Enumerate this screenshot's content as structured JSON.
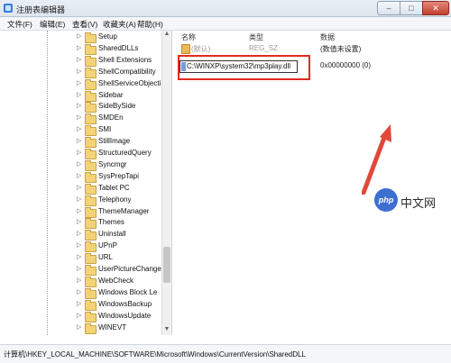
{
  "window": {
    "title": "注册表编辑器",
    "min_label": "–",
    "max_label": "□",
    "close_label": "✕"
  },
  "menu": [
    "文件(F)",
    "编辑(E)",
    "查看(V)",
    "收藏夹(A)",
    "帮助(H)"
  ],
  "tree": {
    "items": [
      "Setup",
      "SharedDLLs",
      "Shell Extensions",
      "ShellCompatibility",
      "ShellServiceObjecti",
      "Sidebar",
      "SideBySide",
      "SMDEn",
      "SMI",
      "StillImage",
      "StructuredQuery",
      "Syncmgr",
      "SysPrepTapi",
      "Tablet PC",
      "Telephony",
      "ThemeManager",
      "Themes",
      "Uninstall",
      "UPnP",
      "URL",
      "UserPictureChange",
      "WebCheck",
      "Windows Block Le",
      "WindowsBackup",
      "WindowsUpdate",
      "WINEVT"
    ]
  },
  "values": {
    "headers": {
      "name": "名称",
      "type": "类型",
      "data": "数据"
    },
    "default_row": {
      "name": "(默认)",
      "type": "REG_SZ",
      "data": "(数值未设置)"
    },
    "edit_value": "C:\\WINXP\\system32\\mp3play.dll",
    "second_data": "0x00000000 (0)"
  },
  "watermark": {
    "logo": "php",
    "text": "中文网"
  },
  "status": {
    "path": "计算机\\HKEY_LOCAL_MACHINE\\SOFTWARE\\Microsoft\\Windows\\CurrentVersion\\SharedDLL"
  },
  "colors": {
    "highlight_border": "#e22a20",
    "arrow": "#e0493a"
  }
}
